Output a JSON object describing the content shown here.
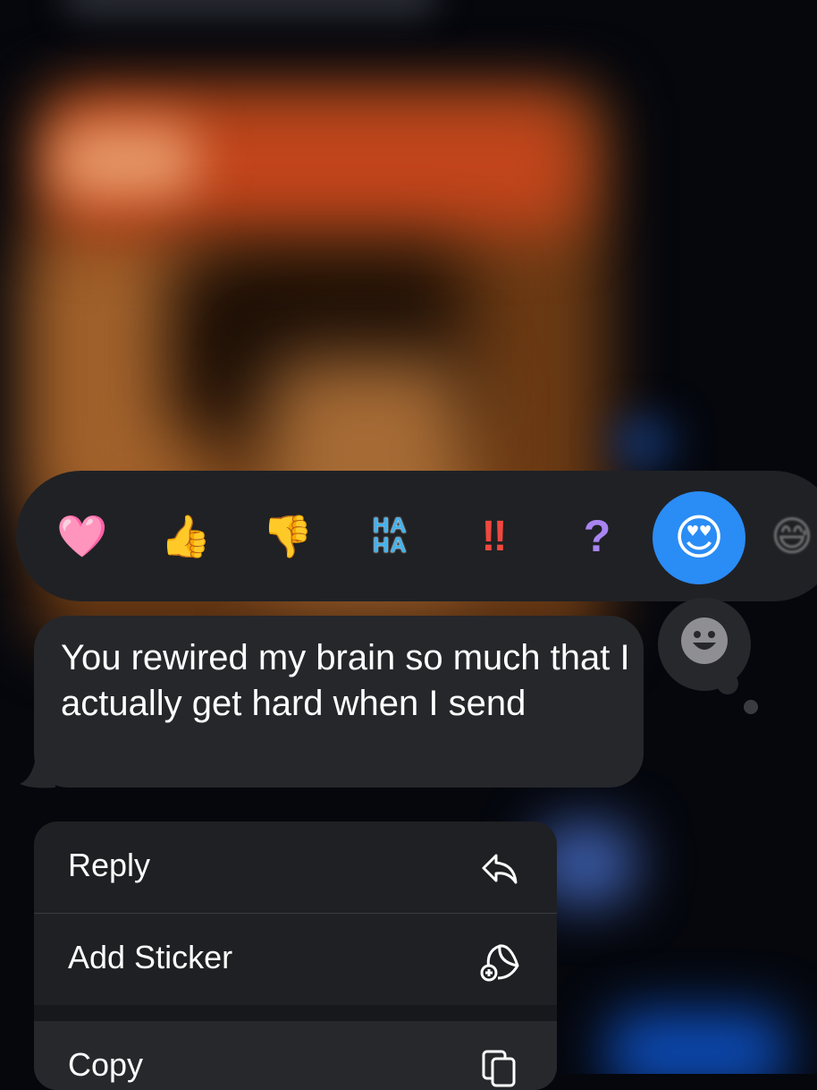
{
  "reactions": [
    {
      "name": "heart",
      "glyph": "🩷"
    },
    {
      "name": "thumbs-up",
      "glyph": "👍"
    },
    {
      "name": "thumbs-down",
      "glyph": "👎"
    },
    {
      "name": "haha",
      "line1": "HA",
      "line2": "HA"
    },
    {
      "name": "exclamation",
      "glyph": "‼"
    },
    {
      "name": "question",
      "glyph": "?"
    },
    {
      "name": "heart-eyes",
      "glyph": "😍",
      "selected": true
    }
  ],
  "message": {
    "text": "You rewired my brain so much that I actually get hard when I send"
  },
  "menu": {
    "items": [
      {
        "label": "Reply",
        "icon": "reply-icon"
      },
      {
        "label": "Add Sticker",
        "icon": "add-sticker-icon"
      },
      {
        "label": "Copy",
        "icon": "copy-icon"
      }
    ]
  },
  "colors": {
    "selected_reaction_bg": "#2a8cf5",
    "bubble_bg": "#26272b",
    "menu_bg": "#1f2023"
  }
}
